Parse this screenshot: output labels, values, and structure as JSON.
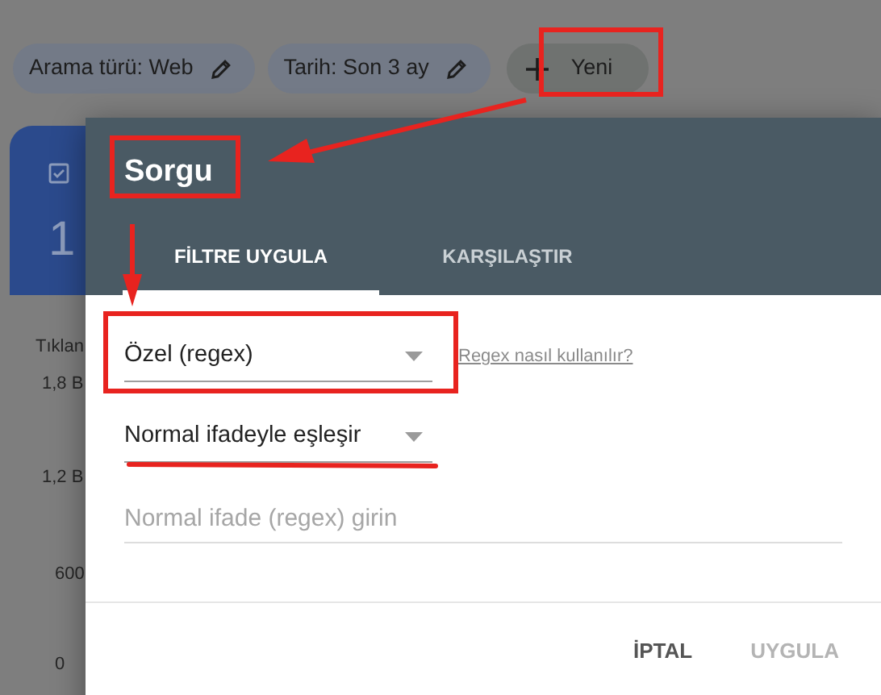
{
  "chips": [
    {
      "label": "Arama türü: Web",
      "kind": "filter"
    },
    {
      "label": "Tarih: Son 3 ay",
      "kind": "filter"
    },
    {
      "label": "Yeni",
      "kind": "add"
    }
  ],
  "background_card": {
    "value": "1"
  },
  "chart_axis": {
    "title": "Tıklan",
    "labels": [
      "1,8 B",
      "1,2 B",
      "600",
      "0"
    ]
  },
  "dialog": {
    "title": "Sorgu",
    "tabs": [
      {
        "label": "FİLTRE UYGULA",
        "selected": true
      },
      {
        "label": "KARŞILAŞTIR",
        "selected": false
      }
    ],
    "selects": [
      {
        "value": "Özel (regex)"
      },
      {
        "value": "Normal ifadeyle eşleşir"
      }
    ],
    "help_link": "Regex nasıl kullanılır?",
    "input": {
      "placeholder": "Normal ifade (regex) girin"
    },
    "buttons": [
      {
        "label": "İPTAL",
        "disabled": false
      },
      {
        "label": "UYGULA",
        "disabled": true
      }
    ]
  }
}
